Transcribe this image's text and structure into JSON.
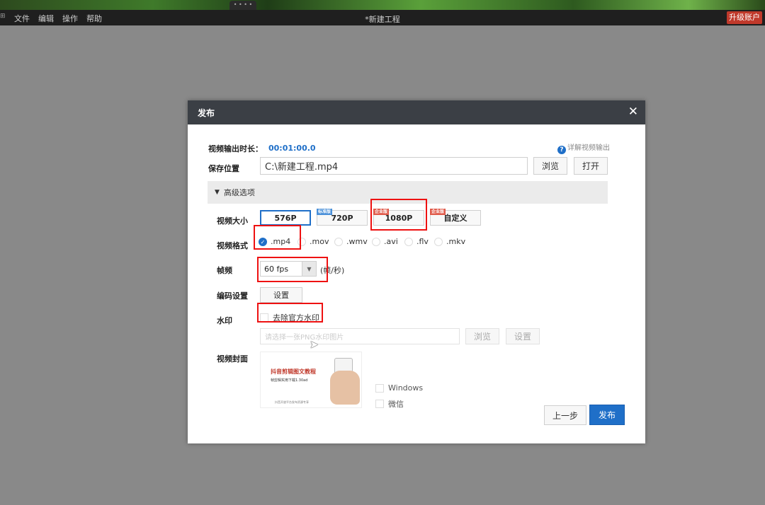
{
  "menubar": {
    "items": [
      "文件",
      "编辑",
      "操作",
      "帮助"
    ],
    "title": "*新建工程",
    "upgrade": "升级账户"
  },
  "dialog": {
    "title": "发布",
    "close": "✕",
    "duration_label": "视频输出时长：",
    "duration_value": "00:01:00.0",
    "help_link": "详解视频输出",
    "save_label": "保存位置",
    "save_path": "C:\\新建工程.mp4",
    "browse": "浏览",
    "open": "打开",
    "advanced": "高级选项",
    "size_label": "视频大小",
    "sizes": [
      {
        "label": "576P",
        "tag": "",
        "selected": true
      },
      {
        "label": "720P",
        "tag": "标准版",
        "selected": false
      },
      {
        "label": "1080P",
        "tag": "企业版",
        "selected": false
      },
      {
        "label": "自定义",
        "tag": "企业版",
        "selected": false
      }
    ],
    "format_label": "视频格式",
    "formats": [
      ".mp4",
      ".mov",
      ".wmv",
      ".avi",
      ".flv",
      ".mkv"
    ],
    "format_selected": ".mp4",
    "fps_label": "帧频",
    "fps_value": "60 fps",
    "fps_unit": "(帧/秒)",
    "encode_label": "编码设置",
    "encode_button": "设置",
    "watermark_label": "水印",
    "remove_watermark": "去除官方水印",
    "watermark_placeholder": "请选择一张PNG水印图片",
    "watermark_browse": "浏览",
    "watermark_settings": "设置",
    "cover_label": "视频封面",
    "cover_title": "抖音剪辑图文教程",
    "cover_subtitle": "帧剪辑实用下载1.30ad",
    "cover_footer": "抖音开放平台发布资源专享",
    "platforms": [
      "Windows",
      "微信"
    ],
    "back": "上一步",
    "publish": "发布"
  }
}
